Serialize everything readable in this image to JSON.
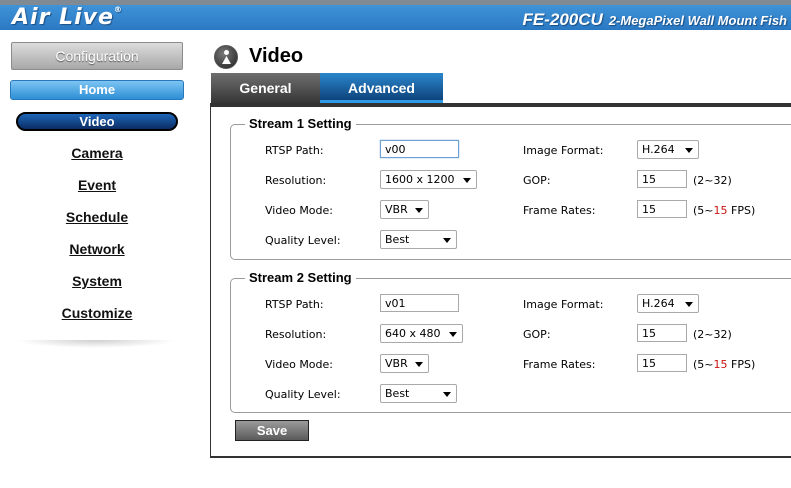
{
  "header": {
    "brand": "Air Live",
    "brand_mark": "®",
    "model_code": "FE-200CU",
    "model_desc": "2-MegaPixel Wall Mount Fish"
  },
  "sidebar": {
    "configuration_label": "Configuration",
    "home_label": "Home",
    "active_label": "Video",
    "links": [
      "Camera",
      "Event",
      "Schedule",
      "Network",
      "System",
      "Customize"
    ]
  },
  "page": {
    "title": "Video",
    "icon": "video-person-icon",
    "tabs": [
      {
        "label": "General",
        "active": false
      },
      {
        "label": "Advanced",
        "active": true
      }
    ]
  },
  "labels": {
    "rtsp_path": "RTSP Path:",
    "resolution": "Resolution:",
    "video_mode": "Video Mode:",
    "quality_level": "Quality Level:",
    "image_format": "Image Format:",
    "gop": "GOP:",
    "frame_rates": "Frame Rates:"
  },
  "streams": [
    {
      "legend": "Stream 1 Setting",
      "rtsp_path": "v00",
      "resolution": "1600 x 1200",
      "video_mode": "VBR",
      "quality_level": "Best",
      "image_format": "H.264",
      "gop": "15",
      "gop_hint": "(2~32)",
      "frame_rate": "15",
      "fps_hint_open": "(5~",
      "fps_hint_max": "15",
      "fps_hint_close": " FPS)"
    },
    {
      "legend": "Stream 2 Setting",
      "rtsp_path": "v01",
      "resolution": "640 x 480",
      "video_mode": "VBR",
      "quality_level": "Best",
      "image_format": "H.264",
      "gop": "15",
      "gop_hint": "(2~32)",
      "frame_rate": "15",
      "fps_hint_open": "(5~",
      "fps_hint_max": "15",
      "fps_hint_close": " FPS)"
    }
  ],
  "actions": {
    "save_label": "Save"
  },
  "colors": {
    "header_blue": "#3388d0",
    "active_tab": "#1a5aa0",
    "limit_red": "#cc1111"
  }
}
